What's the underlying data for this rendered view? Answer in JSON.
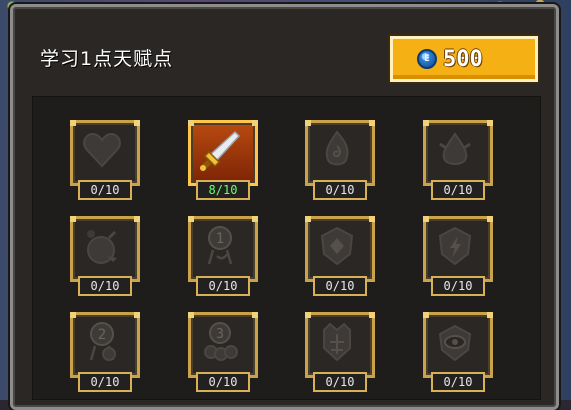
{
  "header": {
    "title": "学习1点天赋点",
    "currency": {
      "icon": "gem-coin-icon",
      "icon_glyph": "E",
      "value": "500"
    }
  },
  "talents": [
    {
      "icon": "heart-icon",
      "level": "0/10",
      "active": false
    },
    {
      "icon": "sword-icon",
      "level": "8/10",
      "active": true
    },
    {
      "icon": "fire-swirl-icon",
      "level": "0/10",
      "active": false
    },
    {
      "icon": "water-drop-icon",
      "level": "0/10",
      "active": false
    },
    {
      "icon": "bomb-icon",
      "level": "0/10",
      "active": false
    },
    {
      "icon": "medal-one-icon",
      "level": "0/10",
      "active": false
    },
    {
      "icon": "diamond-shield-icon",
      "level": "0/10",
      "active": false
    },
    {
      "icon": "lightning-shield-icon",
      "level": "0/10",
      "active": false
    },
    {
      "icon": "medal-two-icon",
      "level": "0/10",
      "active": false
    },
    {
      "icon": "medal-three-icon",
      "level": "0/10",
      "active": false
    },
    {
      "icon": "spiked-crest-icon",
      "level": "0/10",
      "active": false
    },
    {
      "icon": "eye-crest-icon",
      "level": "0/10",
      "active": false
    }
  ],
  "colors": {
    "gold_frame": "#c9a24a",
    "coin_box": "#f5b014",
    "active_level_text": "#6cff6c",
    "inactive_level_text": "#e8e8e8"
  }
}
